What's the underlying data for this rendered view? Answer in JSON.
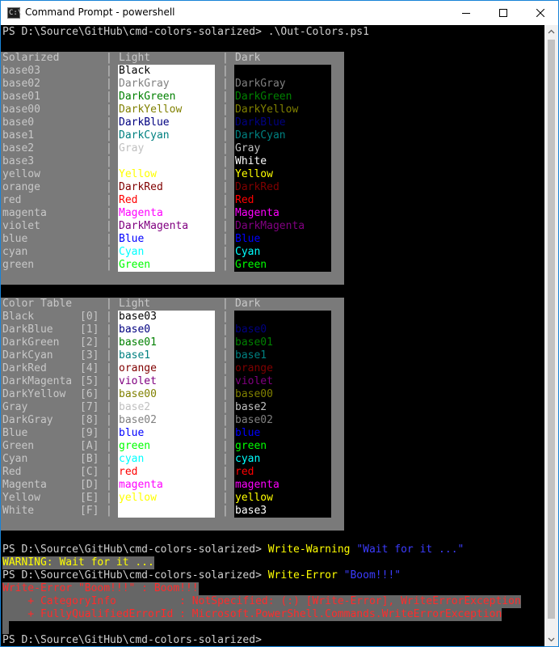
{
  "window": {
    "title": "Command Prompt - powershell",
    "icon_label": "C:\\"
  },
  "prompt": "PS D:\\Source\\GitHub\\cmd-colors-solarized>",
  "commands": {
    "first": ".\\Out-Colors.ps1",
    "warning_cmd": "Write-Warning",
    "warning_arg": "\"Wait for it ...\"",
    "error_cmd": "Write-Error",
    "error_arg": "\"Boom!!!\""
  },
  "output": {
    "warning_line": "WARNING: Wait for it ...",
    "error_line1": "Write-Error \"Boom!!!\" : Boom!!!",
    "error_line2": "    + CategoryInfo          : NotSpecified: (:) [Write-Error], WriteErrorException",
    "error_line3": "    + FullyQualifiedErrorId : Microsoft.PowerShell.Commands.WriteErrorException"
  },
  "table1": {
    "headers": [
      "Solarized",
      "Light",
      "Dark"
    ],
    "rows": [
      {
        "name": "base03",
        "light": "Black",
        "light_color": "#000000",
        "dark": "",
        "dark_color": "#000000"
      },
      {
        "name": "base02",
        "light": "DarkGray",
        "light_color": "#808080",
        "dark": "DarkGray",
        "dark_color": "#808080"
      },
      {
        "name": "base01",
        "light": "DarkGreen",
        "light_color": "#008000",
        "dark": "DarkGreen",
        "dark_color": "#008000"
      },
      {
        "name": "base00",
        "light": "DarkYellow",
        "light_color": "#808000",
        "dark": "DarkYellow",
        "dark_color": "#808000"
      },
      {
        "name": "base0",
        "light": "DarkBlue",
        "light_color": "#000080",
        "dark": "DarkBlue",
        "dark_color": "#000080"
      },
      {
        "name": "base1",
        "light": "DarkCyan",
        "light_color": "#008080",
        "dark": "DarkCyan",
        "dark_color": "#008080"
      },
      {
        "name": "base2",
        "light": "Gray",
        "light_color": "#c0c0c0",
        "dark": "Gray",
        "dark_color": "#c0c0c0"
      },
      {
        "name": "base3",
        "light": "",
        "light_color": "#ffffff",
        "dark": "White",
        "dark_color": "#ffffff"
      },
      {
        "name": "yellow",
        "light": "Yellow",
        "light_color": "#ffff00",
        "dark": "Yellow",
        "dark_color": "#ffff00"
      },
      {
        "name": "orange",
        "light": "DarkRed",
        "light_color": "#800000",
        "dark": "DarkRed",
        "dark_color": "#800000"
      },
      {
        "name": "red",
        "light": "Red",
        "light_color": "#ff0000",
        "dark": "Red",
        "dark_color": "#ff0000"
      },
      {
        "name": "magenta",
        "light": "Magenta",
        "light_color": "#ff00ff",
        "dark": "Magenta",
        "dark_color": "#ff00ff"
      },
      {
        "name": "violet",
        "light": "DarkMagenta",
        "light_color": "#800080",
        "dark": "DarkMagenta",
        "dark_color": "#800080"
      },
      {
        "name": "blue",
        "light": "Blue",
        "light_color": "#0000ff",
        "dark": "Blue",
        "dark_color": "#0000ff"
      },
      {
        "name": "cyan",
        "light": "Cyan",
        "light_color": "#00ffff",
        "dark": "Cyan",
        "dark_color": "#00ffff"
      },
      {
        "name": "green",
        "light": "Green",
        "light_color": "#00ff00",
        "dark": "Green",
        "dark_color": "#00ff00"
      }
    ]
  },
  "table2": {
    "headers": [
      "Color Table",
      "Light",
      "Dark"
    ],
    "rows": [
      {
        "name": "Black",
        "index": "[0]",
        "light": "base03",
        "light_color": "#000000",
        "dark": "",
        "dark_color": "#000000"
      },
      {
        "name": "DarkBlue",
        "index": "[1]",
        "light": "base0",
        "light_color": "#000080",
        "dark": "base0",
        "dark_color": "#000080"
      },
      {
        "name": "DarkGreen",
        "index": "[2]",
        "light": "base01",
        "light_color": "#008000",
        "dark": "base01",
        "dark_color": "#008000"
      },
      {
        "name": "DarkCyan",
        "index": "[3]",
        "light": "base1",
        "light_color": "#008080",
        "dark": "base1",
        "dark_color": "#008080"
      },
      {
        "name": "DarkRed",
        "index": "[4]",
        "light": "orange",
        "light_color": "#800000",
        "dark": "orange",
        "dark_color": "#800000"
      },
      {
        "name": "DarkMagenta",
        "index": "[5]",
        "light": "violet",
        "light_color": "#800080",
        "dark": "violet",
        "dark_color": "#800080"
      },
      {
        "name": "DarkYellow",
        "index": "[6]",
        "light": "base00",
        "light_color": "#808000",
        "dark": "base00",
        "dark_color": "#808000"
      },
      {
        "name": "Gray",
        "index": "[7]",
        "light": "base2",
        "light_color": "#c0c0c0",
        "dark": "base2",
        "dark_color": "#c0c0c0"
      },
      {
        "name": "DarkGray",
        "index": "[8]",
        "light": "base02",
        "light_color": "#808080",
        "dark": "base02",
        "dark_color": "#808080"
      },
      {
        "name": "Blue",
        "index": "[9]",
        "light": "blue",
        "light_color": "#0000ff",
        "dark": "blue",
        "dark_color": "#0000ff"
      },
      {
        "name": "Green",
        "index": "[A]",
        "light": "green",
        "light_color": "#00ff00",
        "dark": "green",
        "dark_color": "#00ff00"
      },
      {
        "name": "Cyan",
        "index": "[B]",
        "light": "cyan",
        "light_color": "#00ffff",
        "dark": "cyan",
        "dark_color": "#00ffff"
      },
      {
        "name": "Red",
        "index": "[C]",
        "light": "red",
        "light_color": "#ff0000",
        "dark": "red",
        "dark_color": "#ff0000"
      },
      {
        "name": "Magenta",
        "index": "[D]",
        "light": "magenta",
        "light_color": "#ff00ff",
        "dark": "magenta",
        "dark_color": "#ff00ff"
      },
      {
        "name": "Yellow",
        "index": "[E]",
        "light": "yellow",
        "light_color": "#ffff00",
        "dark": "yellow",
        "dark_color": "#ffff00"
      },
      {
        "name": "White",
        "index": "[F]",
        "light": "",
        "light_color": "#ffffff",
        "dark": "base3",
        "dark_color": "#ffffff"
      }
    ]
  },
  "icons": {
    "app": "console-icon",
    "minimize": "minimize-icon",
    "maximize": "maximize-icon",
    "close": "close-icon",
    "scroll_up": "chevron-up-icon",
    "scroll_down": "chevron-down-icon"
  }
}
